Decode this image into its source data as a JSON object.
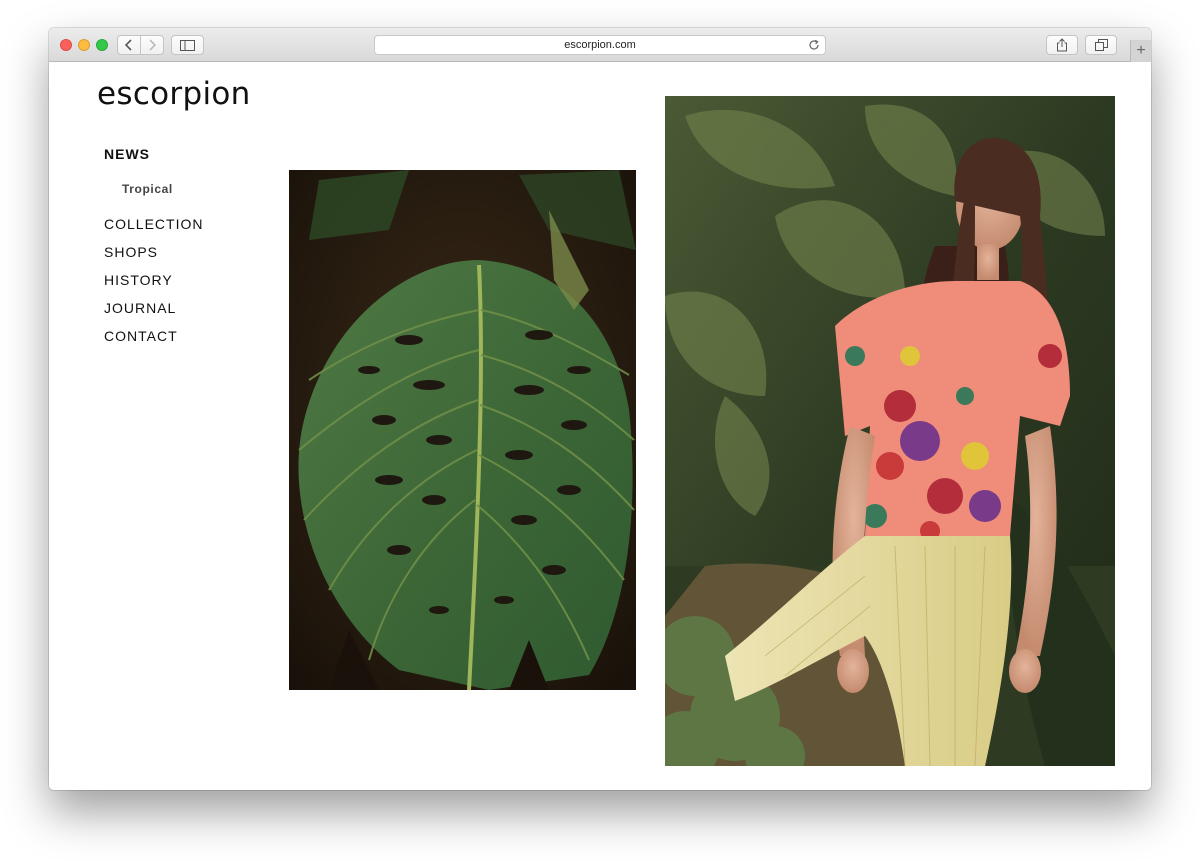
{
  "browser": {
    "url": "escorpion.com",
    "icons": {
      "back": "chevron-left-icon",
      "forward": "chevron-right-icon",
      "sidebar": "sidebar-icon",
      "reload": "reload-icon",
      "share": "share-icon",
      "tabs": "tabs-icon",
      "new_tab": "plus-icon"
    }
  },
  "site": {
    "logo": "escorpion",
    "nav": [
      {
        "label": "NEWS",
        "active": true
      },
      {
        "label": "COLLECTION"
      },
      {
        "label": "SHOPS"
      },
      {
        "label": "HISTORY"
      },
      {
        "label": "JOURNAL"
      },
      {
        "label": "CONTACT"
      }
    ],
    "news_sub": "Tropical"
  },
  "colors": {
    "leaf_green": "#3f6b3a",
    "foliage_dark": "#2a3a22",
    "shirt_coral": "#f08c7a",
    "pants_yellow": "#e8dca0"
  }
}
